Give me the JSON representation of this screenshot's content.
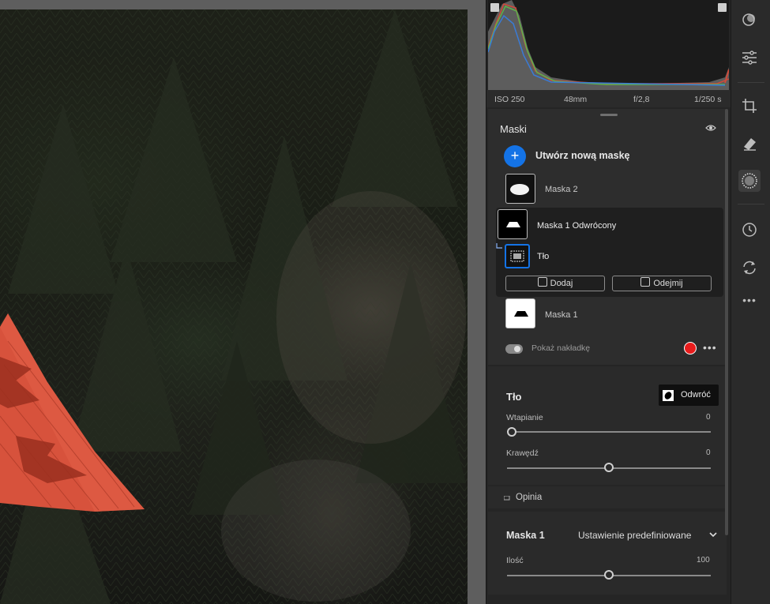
{
  "histogram": {
    "exif": {
      "iso": "ISO 250",
      "focal": "48mm",
      "aperture": "f/2,8",
      "shutter": "1/250 s"
    }
  },
  "masks": {
    "title": "Maski",
    "create_label": "Utwórz nową maskę",
    "items": [
      {
        "label": "Maska 2"
      },
      {
        "label": "Maska 1 Odwrócony"
      },
      {
        "label": "Tło"
      },
      {
        "label": "Maska 1"
      }
    ],
    "add_label": "Dodaj",
    "subtract_label": "Odejmij",
    "overlay_label": "Pokaż nakładkę",
    "overlay_color": "#e81c1c"
  },
  "background_section": {
    "title": "Tło",
    "invert_label": "Odwróć",
    "sliders": [
      {
        "label": "Wtapianie",
        "value": "0",
        "fraction": 0.0
      },
      {
        "label": "Krawędź",
        "value": "0",
        "fraction": 0.5
      }
    ]
  },
  "feedback": {
    "label": "Opinia"
  },
  "mask1_section": {
    "title": "Maska 1",
    "preset_label": "Ustawienie predefiniowane",
    "amount_label": "Ilość",
    "amount_value": "100",
    "amount_fraction": 0.5
  },
  "toolbar": {
    "tools": [
      "edit-icon",
      "sliders-icon",
      "crop-icon",
      "eraser-icon",
      "masking-icon",
      "history-icon",
      "versions-icon",
      "more-icon"
    ]
  }
}
